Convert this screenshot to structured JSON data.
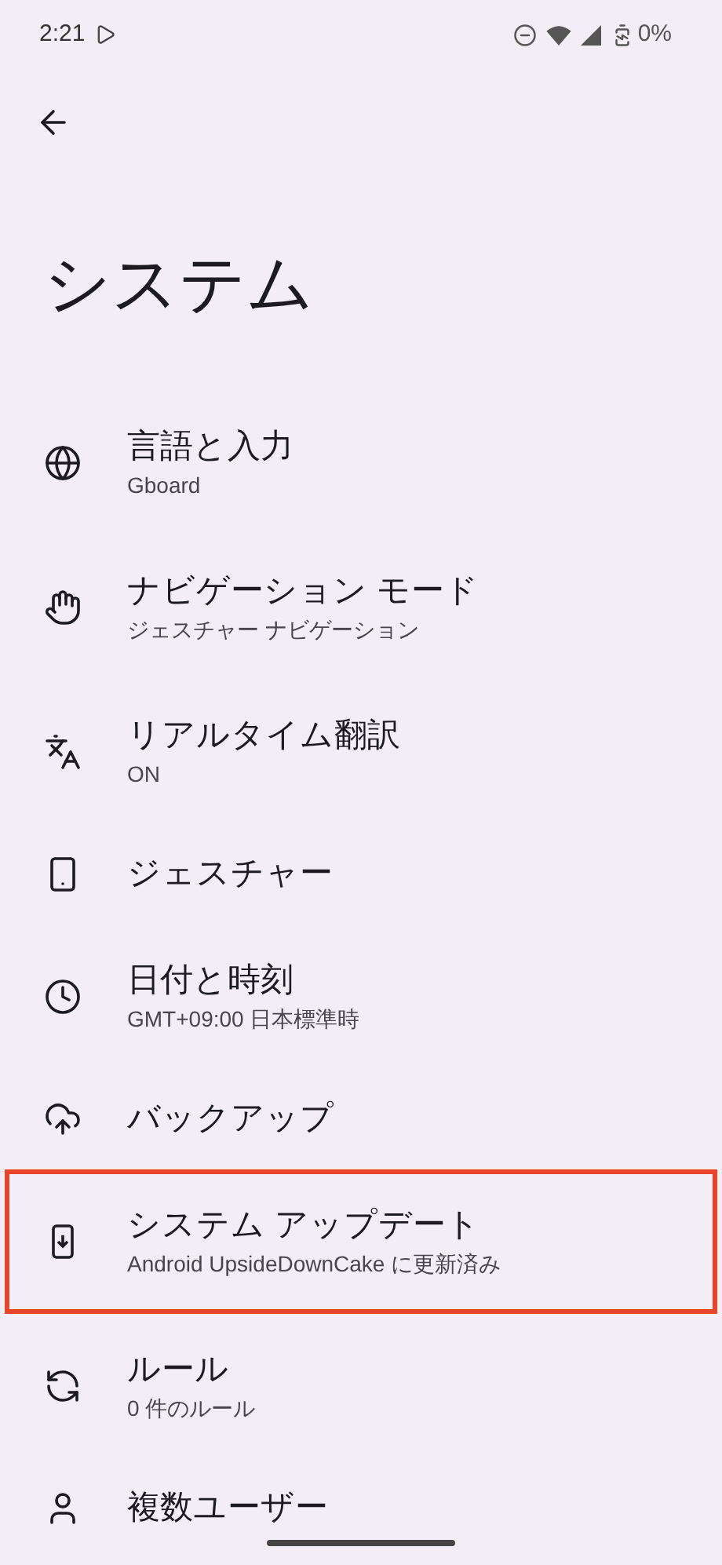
{
  "status_bar": {
    "time": "2:21",
    "battery": "0%"
  },
  "title": "システム",
  "items": [
    {
      "title": "言語と入力",
      "subtitle": "Gboard",
      "highlighted": false
    },
    {
      "title": "ナビゲーション モード",
      "subtitle": "ジェスチャー ナビゲーション",
      "highlighted": false
    },
    {
      "title": "リアルタイム翻訳",
      "subtitle": "ON",
      "highlighted": false
    },
    {
      "title": "ジェスチャー",
      "highlighted": false
    },
    {
      "title": "日付と時刻",
      "subtitle": "GMT+09:00 日本標準時",
      "highlighted": false
    },
    {
      "title": "バックアップ",
      "highlighted": false
    },
    {
      "title": "システム アップデート",
      "subtitle": "Android UpsideDownCake に更新済み",
      "highlighted": true
    },
    {
      "title": "ルール",
      "subtitle": "0 件のルール",
      "highlighted": false
    },
    {
      "title": "複数ユーザー",
      "highlighted": false
    }
  ]
}
